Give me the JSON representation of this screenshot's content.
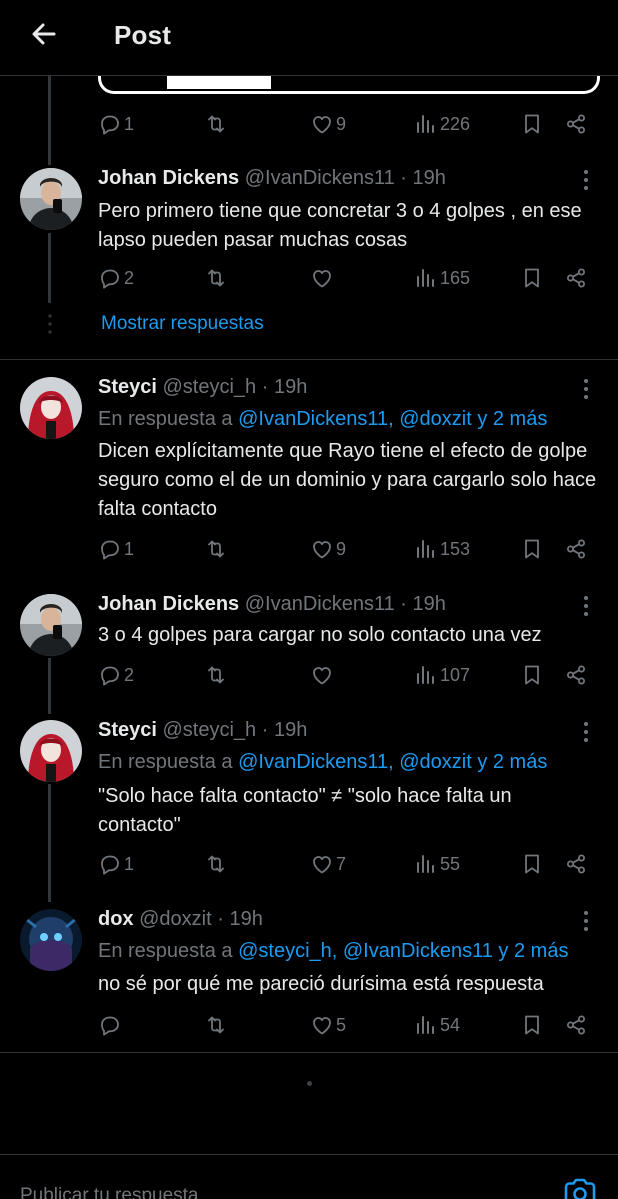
{
  "header": {
    "title": "Post"
  },
  "icons": {
    "back": "arrow-left-icon",
    "reply": "speech-bubble-icon",
    "retweet": "retweet-icon",
    "like": "heart-icon",
    "views": "bar-chart-icon",
    "bookmark": "bookmark-icon",
    "share": "share-icon",
    "more": "three-dots-icon",
    "camera": "camera-icon"
  },
  "colors": {
    "background": "#000000",
    "text": "#e7e9ea",
    "muted": "#71767b",
    "link": "#1d9bf0",
    "border": "#2f3336"
  },
  "prev_post": {
    "replies": "1",
    "retweets": "",
    "likes": "9",
    "views": "226"
  },
  "posts": [
    {
      "name": "Johan Dickens",
      "handle": "@IvanDickens11",
      "time": "· 19h",
      "reply_prefix": "",
      "reply_mentions": "",
      "text": "Pero primero tiene que concretar 3 o 4 golpes , en ese lapso pueden pasar muchas cosas",
      "replies": "2",
      "retweets": "",
      "likes": "",
      "views": "165"
    },
    {
      "name": "Steyci",
      "handle": "@steyci_h",
      "time": "· 19h",
      "reply_prefix": "En respuesta a ",
      "reply_mentions": "@IvanDickens11, @doxzit y 2 más",
      "text": "Dicen explícitamente que Rayo tiene el efecto de golpe seguro como el de un dominio y para cargarlo solo hace falta contacto",
      "replies": "1",
      "retweets": "",
      "likes": "9",
      "views": "153"
    },
    {
      "name": "Johan Dickens",
      "handle": "@IvanDickens11",
      "time": "· 19h",
      "reply_prefix": "",
      "reply_mentions": "",
      "text": "3 o 4 golpes para cargar no solo contacto una vez",
      "replies": "2",
      "retweets": "",
      "likes": "",
      "views": "107"
    },
    {
      "name": "Steyci",
      "handle": "@steyci_h",
      "time": "· 19h",
      "reply_prefix": "En respuesta a ",
      "reply_mentions": "@IvanDickens11, @doxzit y 2 más",
      "text": "\"Solo hace falta contacto\" ≠ \"solo hace falta un contacto\"",
      "replies": "1",
      "retweets": "",
      "likes": "7",
      "views": "55"
    },
    {
      "name": "dox",
      "handle": "@doxzit",
      "time": "· 19h",
      "reply_prefix": "En respuesta a ",
      "reply_mentions": "@steyci_h, @IvanDickens11 y 2 más",
      "text": "no sé por qué me pareció durísima está respuesta",
      "replies": "",
      "retweets": "",
      "likes": "5",
      "views": "54"
    }
  ],
  "show_replies": "Mostrar respuestas",
  "compose": {
    "placeholder": "Publicar tu respuesta"
  }
}
